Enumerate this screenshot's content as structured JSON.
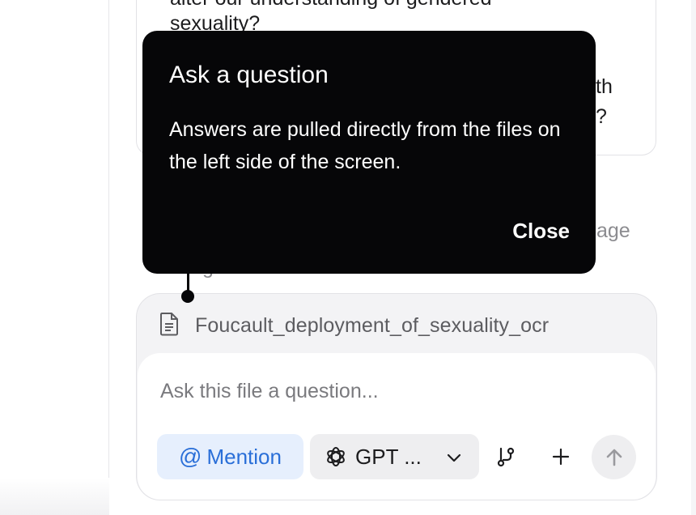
{
  "suggestion_card": {
    "line1": "alter our understanding of gendered",
    "line2": "sexuality?",
    "peek_right_1": "th",
    "peek_right_2": "?"
  },
  "behind_tooltip": {
    "peek_right": "age",
    "peek_left": "g"
  },
  "tooltip": {
    "title": "Ask a question",
    "body": "Answers are pulled directly from the files on the left side of the screen.",
    "close_label": "Close"
  },
  "composer": {
    "file_name": "Foucault_deployment_of_sexuality_ocr",
    "input_placeholder": "Ask this file a question...",
    "mention_label": "Mention",
    "model_label": "GPT ...",
    "icons": {
      "file": "document-icon",
      "mention": "at-icon",
      "model": "openai-icon",
      "chevron": "chevron-down-icon",
      "branch": "branch-icon",
      "add": "plus-icon",
      "send": "arrow-up-icon"
    },
    "colors": {
      "mention_bg": "#e6effd",
      "mention_text": "#2a6fd8",
      "tooltip_bg": "#060608"
    }
  }
}
